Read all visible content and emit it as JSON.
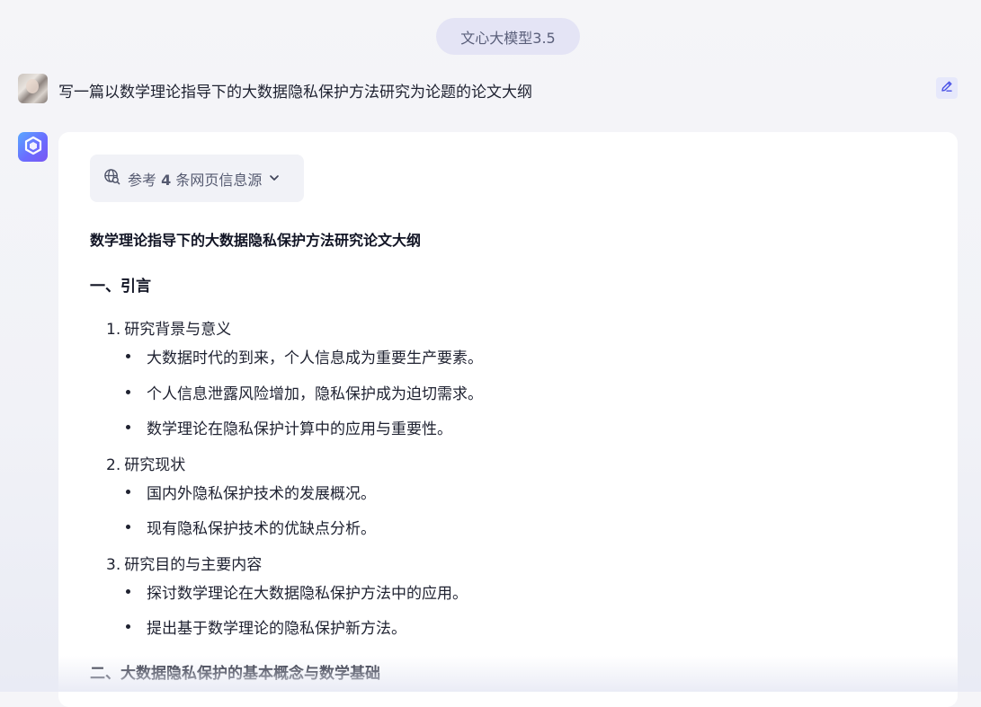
{
  "model_selector": {
    "label": "文心大模型3.5"
  },
  "user_message": {
    "text": "写一篇以数学理论指导下的大数据隐私保护方法研究为论题的论文大纲"
  },
  "sources": {
    "prefix": "参考",
    "count": "4",
    "suffix": "条网页信息源"
  },
  "answer": {
    "title": "数学理论指导下的大数据隐私保护方法研究论文大纲",
    "sections": [
      {
        "heading": "一、引言",
        "items": [
          {
            "number": "1.",
            "label": "研究背景与意义",
            "bullets": [
              "大数据时代的到来，个人信息成为重要生产要素。",
              "个人信息泄露风险增加，隐私保护成为迫切需求。",
              "数学理论在隐私保护计算中的应用与重要性。"
            ]
          },
          {
            "number": "2.",
            "label": "研究现状",
            "bullets": [
              "国内外隐私保护技术的发展概况。",
              "现有隐私保护技术的优缺点分析。"
            ]
          },
          {
            "number": "3.",
            "label": "研究目的与主要内容",
            "bullets": [
              "探讨数学理论在大数据隐私保护方法中的应用。",
              "提出基于数学理论的隐私保护新方法。"
            ]
          }
        ]
      },
      {
        "heading": "二、大数据隐私保护的基本概念与数学基础",
        "items": []
      }
    ]
  },
  "icons": {
    "edit": "pencil-edit-icon",
    "bot": "ernie-bot-logo-icon",
    "globe": "globe-search-icon",
    "chevron": "chevron-down-icon"
  },
  "colors": {
    "accent": "#5b63f0",
    "pill_bg": "#e4e4f5",
    "card_bg": "#ffffff"
  }
}
